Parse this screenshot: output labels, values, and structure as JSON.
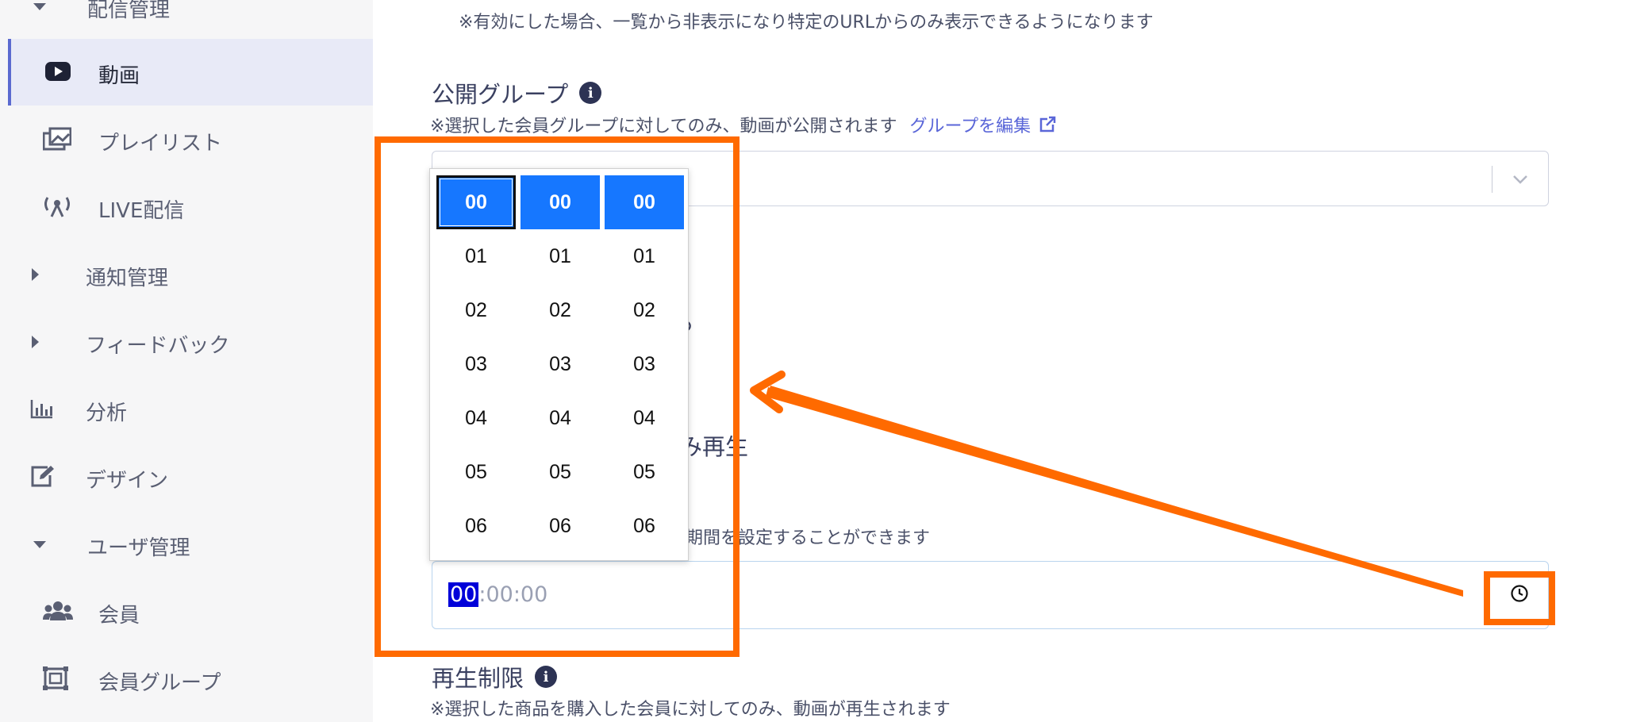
{
  "sidebar": {
    "items": [
      {
        "label": "配信管理"
      },
      {
        "label": "動画"
      },
      {
        "label": "プレイリスト"
      },
      {
        "label": "LIVE配信"
      },
      {
        "label": "通知管理"
      },
      {
        "label": "フィードバック"
      },
      {
        "label": "分析"
      },
      {
        "label": "デザイン"
      },
      {
        "label": "ユーザ管理"
      },
      {
        "label": "会員"
      },
      {
        "label": "会員グループ"
      }
    ]
  },
  "main": {
    "top_note": "※有効にした場合、一覧から非表示になり特定のURLからのみ表示できるようになります",
    "public_group": {
      "title": "公開グループ",
      "note": "※選択した会員グループに対してのみ、動画が公開されます",
      "edit_link": "グループを編集"
    },
    "partial_text_1": "る",
    "partial_text_2": "み再生",
    "partial_note": "期間を設定することができます",
    "time_input": {
      "hour": "00",
      "rest": ":00:00"
    },
    "playback_limit": {
      "title": "再生制限",
      "note": "※選択した商品を購入した会員に対してのみ、動画が再生されます"
    }
  },
  "picker": {
    "hours": [
      "00",
      "01",
      "02",
      "03",
      "04",
      "05",
      "06"
    ],
    "minutes": [
      "00",
      "01",
      "02",
      "03",
      "04",
      "05",
      "06"
    ],
    "seconds": [
      "00",
      "01",
      "02",
      "03",
      "04",
      "05",
      "06"
    ],
    "selected": {
      "hour": "00",
      "minute": "00",
      "second": "00"
    }
  },
  "colors": {
    "annotation": "#ff6a00",
    "selected_cell": "#1677ff",
    "active_nav": "#e8eaf7",
    "link": "#5a66d8"
  },
  "icons": {
    "video": "youtube-play-icon",
    "playlist": "gallery-icon",
    "live": "antenna-icon",
    "analytics": "bar-chart-icon",
    "design": "edit-icon",
    "members": "users-icon",
    "member_group": "frame-icon",
    "clock": "clock-icon",
    "info": "info-icon",
    "external": "external-link-icon"
  }
}
